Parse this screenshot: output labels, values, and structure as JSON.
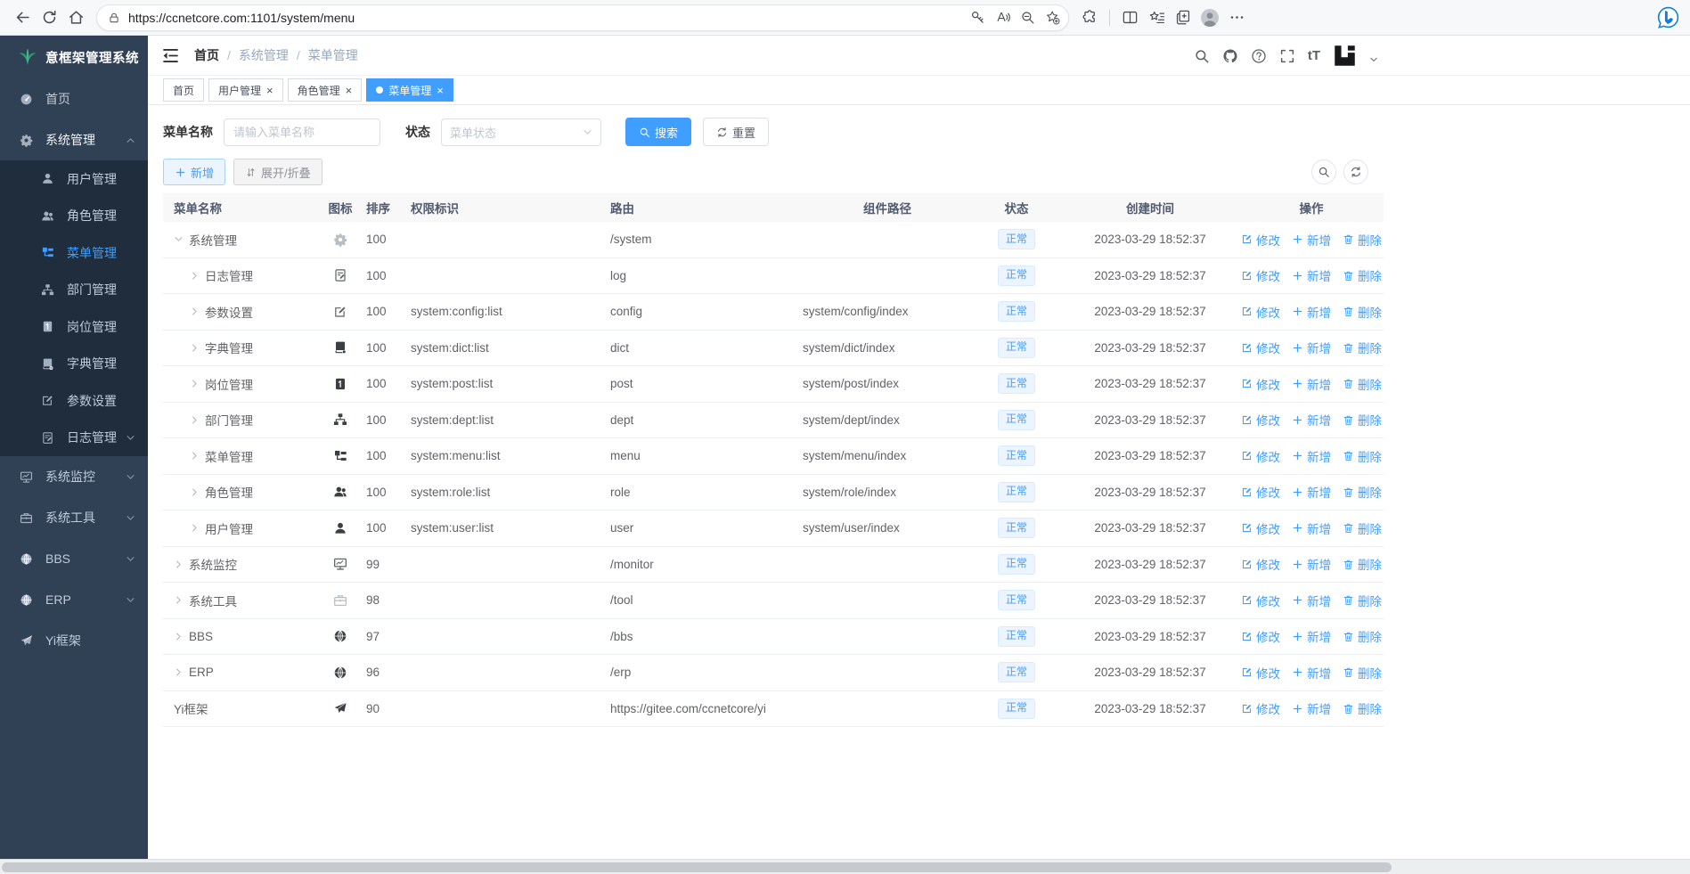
{
  "browser": {
    "url": "https://ccnetcore.com:1101/system/menu"
  },
  "colors": {
    "accent": "#409eff",
    "sidebar_bg": "#304156",
    "submenu_bg": "#1f2d3d",
    "active_tab_bg": "#409eff",
    "status_badge_bg": "#ecf5ff",
    "status_badge_text": "#409eff",
    "logo_green": "#36b381"
  },
  "sidebar": {
    "title": "意框架管理系统",
    "items": [
      {
        "id": "home",
        "label": "首页",
        "icon": "dashboard"
      },
      {
        "id": "system",
        "label": "系统管理",
        "icon": "gear",
        "caret": "up",
        "open": true
      },
      {
        "id": "user",
        "label": "用户管理",
        "icon": "user",
        "child": true
      },
      {
        "id": "role",
        "label": "角色管理",
        "icon": "users",
        "child": true
      },
      {
        "id": "menu",
        "label": "菜单管理",
        "icon": "tree-table",
        "child": true,
        "active": true
      },
      {
        "id": "dept",
        "label": "部门管理",
        "icon": "tree",
        "child": true
      },
      {
        "id": "post",
        "label": "岗位管理",
        "icon": "badge",
        "child": true
      },
      {
        "id": "dict",
        "label": "字典管理",
        "icon": "book",
        "child": true
      },
      {
        "id": "config",
        "label": "参数设置",
        "icon": "edit",
        "child": true
      },
      {
        "id": "log",
        "label": "日志管理",
        "icon": "log",
        "child": true,
        "caret": "down"
      },
      {
        "id": "monitor",
        "label": "系统监控",
        "icon": "monitor",
        "caret": "down"
      },
      {
        "id": "tool",
        "label": "系统工具",
        "icon": "toolbox",
        "caret": "down"
      },
      {
        "id": "bbs",
        "label": "BBS",
        "icon": "globe",
        "caret": "down"
      },
      {
        "id": "erp",
        "label": "ERP",
        "icon": "globe",
        "caret": "down"
      },
      {
        "id": "yi",
        "label": "Yi框架",
        "icon": "plane"
      }
    ]
  },
  "header": {
    "breadcrumb": [
      "首页",
      "系统管理",
      "菜单管理"
    ],
    "font_size_label": "tT"
  },
  "tabs": [
    {
      "id": "home",
      "label": "首页",
      "closable": false,
      "active": false
    },
    {
      "id": "user",
      "label": "用户管理",
      "closable": true,
      "active": false
    },
    {
      "id": "role",
      "label": "角色管理",
      "closable": true,
      "active": false
    },
    {
      "id": "menu",
      "label": "菜单管理",
      "closable": true,
      "active": true
    }
  ],
  "filter": {
    "name_label": "菜单名称",
    "name_placeholder": "请输入菜单名称",
    "status_label": "状态",
    "status_placeholder": "菜单状态",
    "search_label": "搜索",
    "reset_label": "重置"
  },
  "toolbar": {
    "add_label": "新增",
    "toggle_label": "展开/折叠"
  },
  "table": {
    "columns": [
      "菜单名称",
      "图标",
      "排序",
      "权限标识",
      "路由",
      "组件路径",
      "状态",
      "创建时间",
      "操作"
    ],
    "actions": {
      "edit": "修改",
      "add": "新增",
      "remove": "删除"
    },
    "rows": [
      {
        "name": "系统管理",
        "icon": "gear",
        "tone": "light",
        "level": 0,
        "expand": "expanded",
        "sort": "100",
        "permission": "",
        "route": "/system",
        "component": "",
        "status": "正常",
        "created": "2023-03-29 18:52:37"
      },
      {
        "name": "日志管理",
        "icon": "log",
        "tone": "",
        "level": 1,
        "expand": "collapsed",
        "sort": "100",
        "permission": "",
        "route": "log",
        "component": "",
        "status": "正常",
        "created": "2023-03-29 18:52:37"
      },
      {
        "name": "参数设置",
        "icon": "edit",
        "tone": "",
        "level": 1,
        "expand": "collapsed",
        "sort": "100",
        "permission": "system:config:list",
        "route": "config",
        "component": "system/config/index",
        "status": "正常",
        "created": "2023-03-29 18:52:37"
      },
      {
        "name": "字典管理",
        "icon": "book",
        "tone": "dark",
        "level": 1,
        "expand": "collapsed",
        "sort": "100",
        "permission": "system:dict:list",
        "route": "dict",
        "component": "system/dict/index",
        "status": "正常",
        "created": "2023-03-29 18:52:37"
      },
      {
        "name": "岗位管理",
        "icon": "badge",
        "tone": "dark",
        "level": 1,
        "expand": "collapsed",
        "sort": "100",
        "permission": "system:post:list",
        "route": "post",
        "component": "system/post/index",
        "status": "正常",
        "created": "2023-03-29 18:52:37"
      },
      {
        "name": "部门管理",
        "icon": "tree",
        "tone": "dark",
        "level": 1,
        "expand": "collapsed",
        "sort": "100",
        "permission": "system:dept:list",
        "route": "dept",
        "component": "system/dept/index",
        "status": "正常",
        "created": "2023-03-29 18:52:37"
      },
      {
        "name": "菜单管理",
        "icon": "tree-table",
        "tone": "dark",
        "level": 1,
        "expand": "collapsed",
        "sort": "100",
        "permission": "system:menu:list",
        "route": "menu",
        "component": "system/menu/index",
        "status": "正常",
        "created": "2023-03-29 18:52:37"
      },
      {
        "name": "角色管理",
        "icon": "users",
        "tone": "dark",
        "level": 1,
        "expand": "collapsed",
        "sort": "100",
        "permission": "system:role:list",
        "route": "role",
        "component": "system/role/index",
        "status": "正常",
        "created": "2023-03-29 18:52:37"
      },
      {
        "name": "用户管理",
        "icon": "user",
        "tone": "dark",
        "level": 1,
        "expand": "collapsed",
        "sort": "100",
        "permission": "system:user:list",
        "route": "user",
        "component": "system/user/index",
        "status": "正常",
        "created": "2023-03-29 18:52:37"
      },
      {
        "name": "系统监控",
        "icon": "monitor",
        "tone": "",
        "level": 0,
        "expand": "collapsed",
        "sort": "99",
        "permission": "",
        "route": "/monitor",
        "component": "",
        "status": "正常",
        "created": "2023-03-29 18:52:37"
      },
      {
        "name": "系统工具",
        "icon": "toolbox",
        "tone": "light",
        "level": 0,
        "expand": "collapsed",
        "sort": "98",
        "permission": "",
        "route": "/tool",
        "component": "",
        "status": "正常",
        "created": "2023-03-29 18:52:37"
      },
      {
        "name": "BBS",
        "icon": "globe",
        "tone": "dark",
        "level": 0,
        "expand": "collapsed",
        "sort": "97",
        "permission": "",
        "route": "/bbs",
        "component": "",
        "status": "正常",
        "created": "2023-03-29 18:52:37"
      },
      {
        "name": "ERP",
        "icon": "globe",
        "tone": "dark",
        "level": 0,
        "expand": "collapsed",
        "sort": "96",
        "permission": "",
        "route": "/erp",
        "component": "",
        "status": "正常",
        "created": "2023-03-29 18:52:37"
      },
      {
        "name": "Yi框架",
        "icon": "plane",
        "tone": "dark",
        "level": 0,
        "expand": "none",
        "sort": "90",
        "permission": "",
        "route": "https://gitee.com/ccnetcore/yi",
        "component": "",
        "status": "正常",
        "created": "2023-03-29 18:52:37"
      }
    ]
  }
}
